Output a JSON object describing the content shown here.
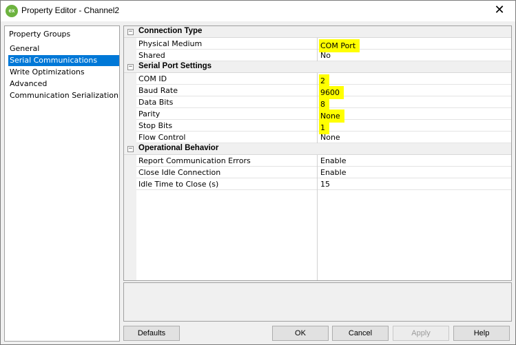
{
  "window": {
    "title": "Property Editor - Channel2",
    "icon_text": "ex",
    "close_glyph": "✕"
  },
  "groups": {
    "header": "Property Groups",
    "items": [
      {
        "label": "General",
        "selected": false
      },
      {
        "label": "Serial Communications",
        "selected": true
      },
      {
        "label": "Write Optimizations",
        "selected": false
      },
      {
        "label": "Advanced",
        "selected": false
      },
      {
        "label": "Communication Serialization",
        "selected": false
      }
    ]
  },
  "grid": {
    "categories": [
      {
        "name": "Connection Type",
        "expander": "−",
        "properties": [
          {
            "name": "Physical Medium",
            "value": "COM Port",
            "highlighted": true
          },
          {
            "name": "Shared",
            "value": "No",
            "highlighted": false
          }
        ]
      },
      {
        "name": "Serial Port Settings",
        "expander": "−",
        "properties": [
          {
            "name": "COM ID",
            "value": "2",
            "highlighted": true
          },
          {
            "name": "Baud Rate",
            "value": "9600",
            "highlighted": true
          },
          {
            "name": "Data Bits",
            "value": "8",
            "highlighted": true
          },
          {
            "name": "Parity",
            "value": "None",
            "highlighted": true
          },
          {
            "name": "Stop Bits",
            "value": "1",
            "highlighted": true
          },
          {
            "name": "Flow Control",
            "value": "None",
            "highlighted": false
          }
        ]
      },
      {
        "name": "Operational Behavior",
        "expander": "−",
        "properties": [
          {
            "name": "Report Communication Errors",
            "value": "Enable",
            "highlighted": false
          },
          {
            "name": "Close Idle Connection",
            "value": "Enable",
            "highlighted": false
          },
          {
            "name": "Idle Time to Close (s)",
            "value": "15",
            "highlighted": false
          }
        ]
      }
    ],
    "highlight_color": "#ffff00"
  },
  "buttons": {
    "defaults": "Defaults",
    "ok": "OK",
    "cancel": "Cancel",
    "apply": "Apply",
    "help": "Help"
  },
  "colors": {
    "selection": "#0078d7",
    "dialog_bg": "#f0f0f0"
  }
}
